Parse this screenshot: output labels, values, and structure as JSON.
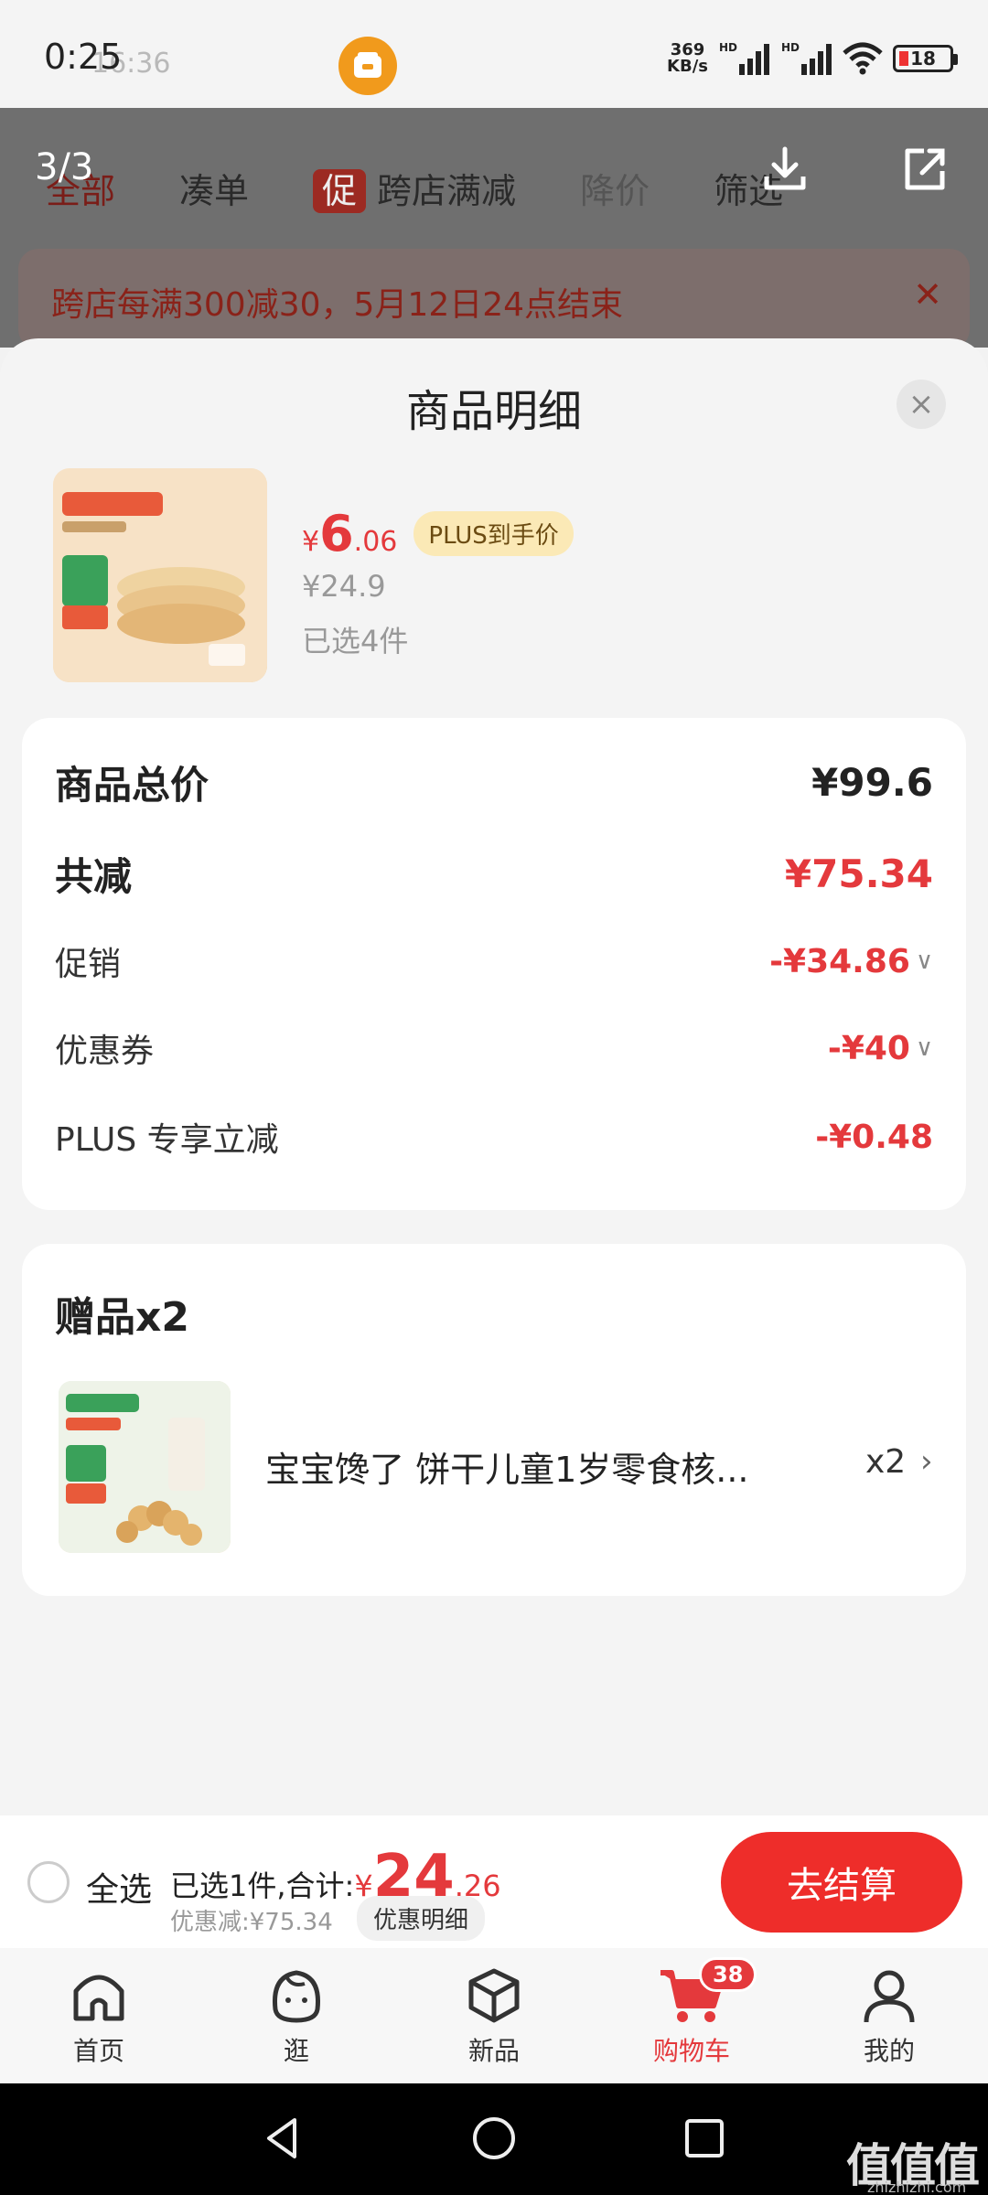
{
  "status_bar": {
    "time": "0:25",
    "time_ghost": "16:36",
    "net_speed_value": "369",
    "net_speed_unit": "KB/s",
    "signal_label": "HD",
    "battery": "18"
  },
  "image_viewer": {
    "counter": "3/3",
    "download_icon": "download-icon",
    "share_icon": "share-icon"
  },
  "background_page": {
    "tabs": [
      "全部",
      "凑单",
      "跨店满减",
      "降价",
      "筛选"
    ],
    "tag_label": "促",
    "banner_text": "跨店每满300减30，5月12日24点结束",
    "banner_close": "✕"
  },
  "sheet": {
    "title": "商品明细",
    "close": "×"
  },
  "product": {
    "price_symbol": "¥",
    "price_int": "6",
    "price_dec": ".06",
    "plus_tag": "PLUS到手价",
    "original_price": "¥24.9",
    "selected": "已选4件"
  },
  "summary": {
    "total_label": "商品总价",
    "total_value": "¥99.6",
    "reduce_label": "共减",
    "reduce_value": "¥75.34",
    "promo_label": "促销",
    "promo_value": "-¥34.86",
    "coupon_label": "优惠券",
    "coupon_value": "-¥40",
    "plus_label": "PLUS 专享立减",
    "plus_value": "-¥0.48"
  },
  "gift": {
    "title": "赠品x2",
    "name": "宝宝馋了 饼干儿童1岁零食核...",
    "qty": "x2"
  },
  "checkout": {
    "select_all": "全选",
    "total_prefix": "已选1件,合计:",
    "total_yen": "¥",
    "total_int": "24",
    "total_dec": ".26",
    "saved": "优惠减:¥75.34",
    "detail_button": "优惠明细",
    "checkout_button": "去结算"
  },
  "tabbar": {
    "items": [
      {
        "label": "首页",
        "icon": "home-icon"
      },
      {
        "label": "逛",
        "icon": "face-icon"
      },
      {
        "label": "新品",
        "icon": "cube-icon"
      },
      {
        "label": "购物车",
        "icon": "cart-icon",
        "badge": "38"
      },
      {
        "label": "我的",
        "icon": "user-icon"
      }
    ]
  },
  "watermark": {
    "main": "值值值",
    "sub": "zhizhizhi.com"
  },
  "colors": {
    "accent": "#e4393c",
    "checkout_button": "#ee2d2a",
    "plus_tag_bg": "#fbe9b6",
    "status_orange": "#f19a1c"
  }
}
